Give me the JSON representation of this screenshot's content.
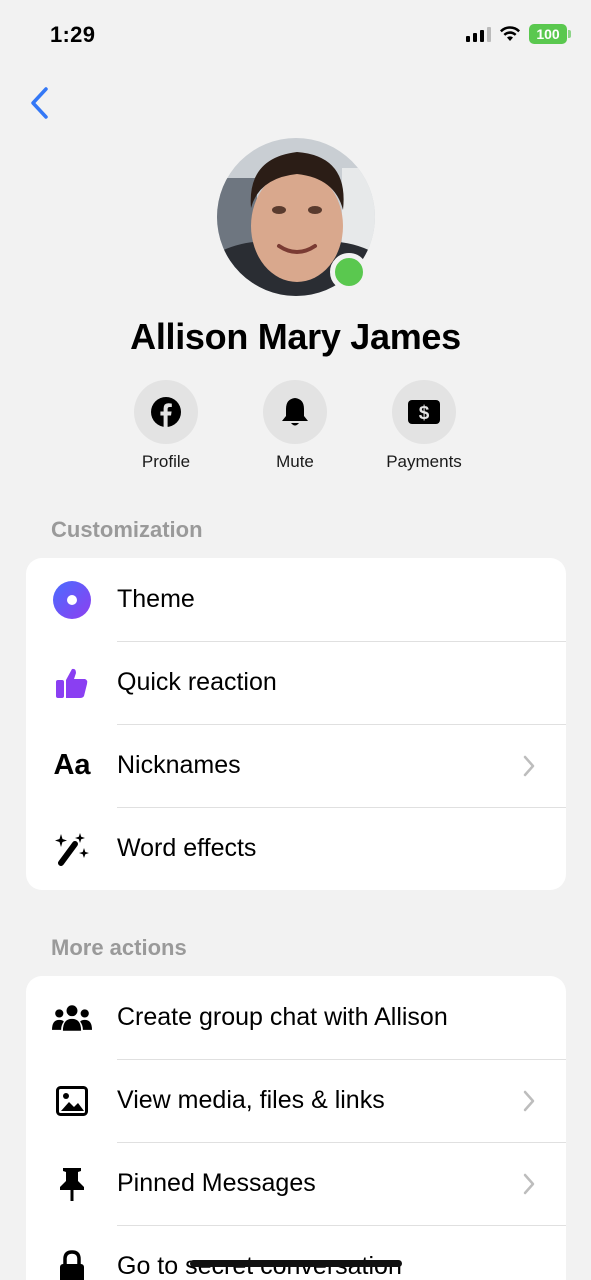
{
  "status_bar": {
    "time": "1:29",
    "battery": "100"
  },
  "profile": {
    "name": "Allison Mary James"
  },
  "actions": [
    {
      "label": "Profile",
      "icon": "facebook-icon"
    },
    {
      "label": "Mute",
      "icon": "bell-icon"
    },
    {
      "label": "Payments",
      "icon": "dollar-icon"
    }
  ],
  "customization": {
    "header": "Customization",
    "items": [
      {
        "label": "Theme",
        "icon": "theme-icon"
      },
      {
        "label": "Quick reaction",
        "icon": "thumbs-up-icon"
      },
      {
        "label": "Nicknames",
        "icon": "text-aa-icon"
      },
      {
        "label": "Word effects",
        "icon": "magic-wand-icon"
      }
    ]
  },
  "more_actions": {
    "header": "More actions",
    "items": [
      {
        "label": "Create group chat with Allison",
        "icon": "group-icon"
      },
      {
        "label": "View media, files & links",
        "icon": "photo-icon"
      },
      {
        "label": "Pinned Messages",
        "icon": "pin-icon"
      },
      {
        "label": "Go to secret conversation",
        "icon": "lock-icon"
      }
    ]
  },
  "colors": {
    "accent_blue": "#3478f6",
    "online_green": "#5ac84f",
    "theme_purple": "#7b3ff2"
  }
}
